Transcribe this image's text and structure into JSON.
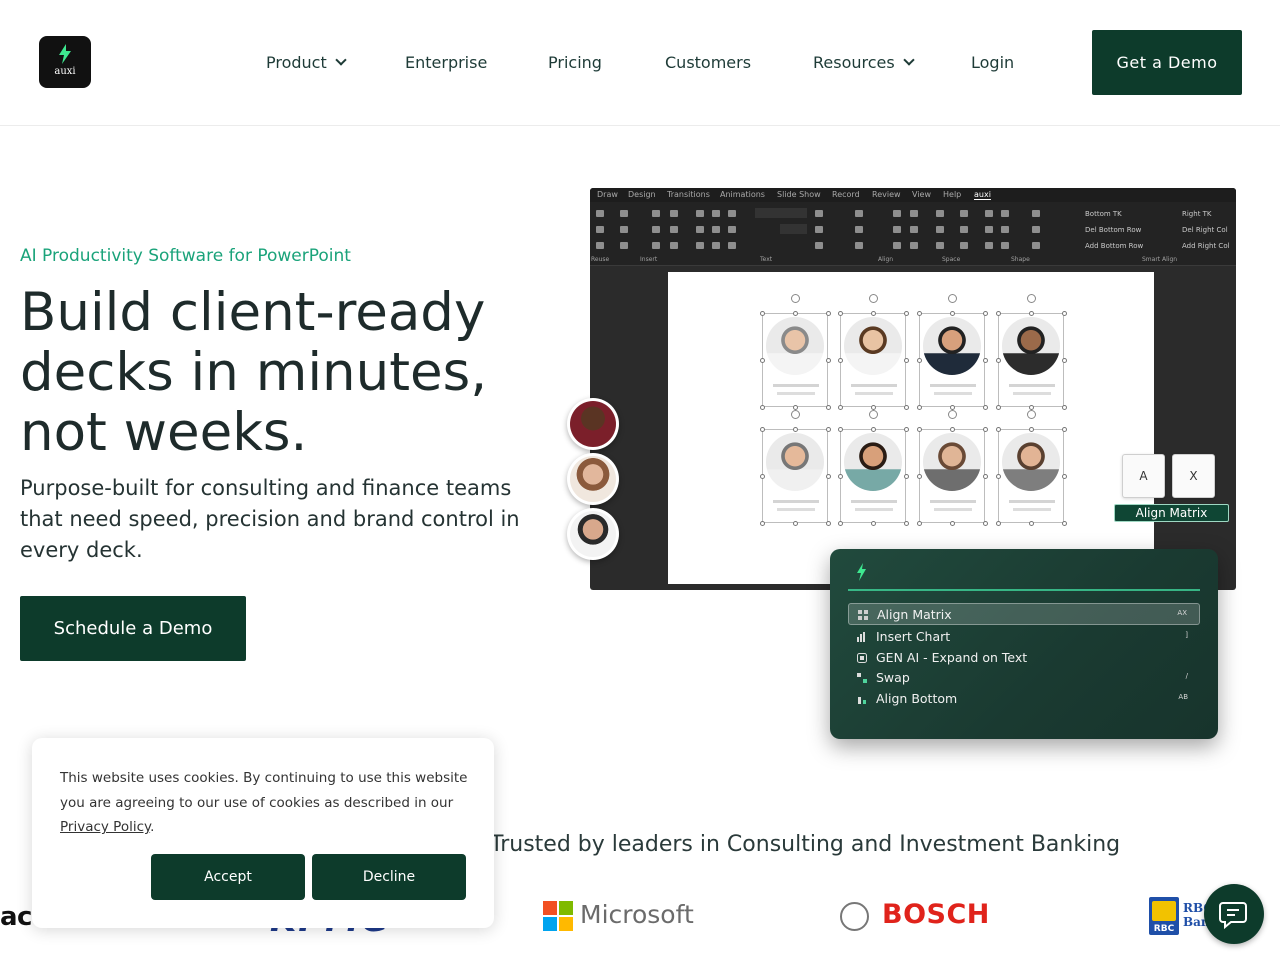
{
  "brand": {
    "logo_text": "auxi",
    "primary_color": "#0d3b2b",
    "accent_color": "#1aa37a"
  },
  "nav": {
    "items": [
      {
        "label": "Product",
        "has_dropdown": true
      },
      {
        "label": "Enterprise",
        "has_dropdown": false
      },
      {
        "label": "Pricing",
        "has_dropdown": false
      },
      {
        "label": "Customers",
        "has_dropdown": false
      },
      {
        "label": "Resources",
        "has_dropdown": true
      },
      {
        "label": "Login",
        "has_dropdown": false
      }
    ],
    "cta_label": "Get a Demo"
  },
  "hero": {
    "eyebrow": "AI Productivity Software for PowerPoint",
    "headline": "Build client-ready decks in minutes, not weeks.",
    "subheadline": "Purpose-built for consulting and finance teams that need speed, precision and brand control in every deck.",
    "cta_label": "Schedule a Demo"
  },
  "app_preview": {
    "ribbon_tabs": [
      "Draw",
      "Design",
      "Transitions",
      "Animations",
      "Slide Show",
      "Record",
      "Review",
      "View",
      "Help",
      "auxi"
    ],
    "ribbon_groups": [
      "Reuse",
      "Insert",
      "Text",
      "Align",
      "Space",
      "Shape",
      "Smart Align"
    ],
    "ribbon_commands": [
      "Bottom TK",
      "Right TK",
      "Del Bottom Row",
      "Del Right Col",
      "Add Bottom Row",
      "Add Right Col"
    ],
    "keys": [
      "A",
      "X"
    ],
    "shortcut_label": "Align Matrix",
    "palette": [
      {
        "label": "Align Matrix",
        "shortcut": "AX",
        "icon": "grid-icon",
        "selected": true
      },
      {
        "label": "Insert Chart",
        "shortcut": "]",
        "icon": "bar-chart-icon",
        "selected": false
      },
      {
        "label": "GEN AI - Expand on Text",
        "shortcut": "",
        "icon": "ai-icon",
        "selected": false
      },
      {
        "label": "Swap",
        "shortcut": "/",
        "icon": "swap-icon",
        "selected": false
      },
      {
        "label": "Align Bottom",
        "shortcut": "AB",
        "icon": "align-bottom-icon",
        "selected": false
      }
    ]
  },
  "trusted": {
    "text": "Trusted by leaders in Consulting and Investment Banking",
    "logos": [
      "accenture",
      "KPMG",
      "Microsoft",
      "BOSCH",
      "RBC Royal Bank"
    ]
  },
  "cookie": {
    "text": "This website uses cookies. By continuing to use this website you are agreeing to our use of cookies as described in our ",
    "link_label": "Privacy Policy",
    "end": ".",
    "accept_label": "Accept",
    "decline_label": "Decline"
  }
}
